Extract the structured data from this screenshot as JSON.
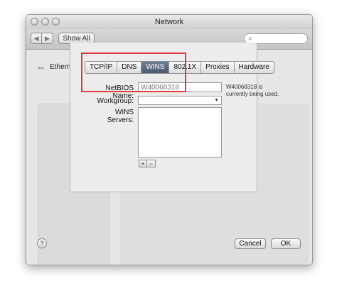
{
  "window": {
    "title": "Network"
  },
  "toolbar": {
    "show_all_label": "Show All",
    "back_icon": "chevron-left-icon",
    "forward_icon": "chevron-right-icon",
    "search_icon": "magnifier-icon"
  },
  "header": {
    "interface_label": "Ethernet",
    "interface_icon": "network-arrows-icon"
  },
  "tabs": [
    {
      "label": "TCP/IP",
      "active": false
    },
    {
      "label": "DNS",
      "active": false
    },
    {
      "label": "WINS",
      "active": true
    },
    {
      "label": "802.1X",
      "active": false
    },
    {
      "label": "Proxies",
      "active": false
    },
    {
      "label": "Hardware",
      "active": false
    }
  ],
  "form": {
    "netbios_label": "NetBIOS Name:",
    "netbios_value": "W40068318",
    "netbios_note": "W40068318 is currently being used.",
    "workgroup_label": "Workgroup:",
    "workgroup_value": "",
    "wins_servers_label": "WINS Servers:",
    "add_label": "+",
    "remove_label": "−"
  },
  "footer": {
    "help_label": "?",
    "cancel_label": "Cancel",
    "ok_label": "OK"
  },
  "colors": {
    "highlight": "#e0393e",
    "active_tab": "#5a6a7e"
  }
}
